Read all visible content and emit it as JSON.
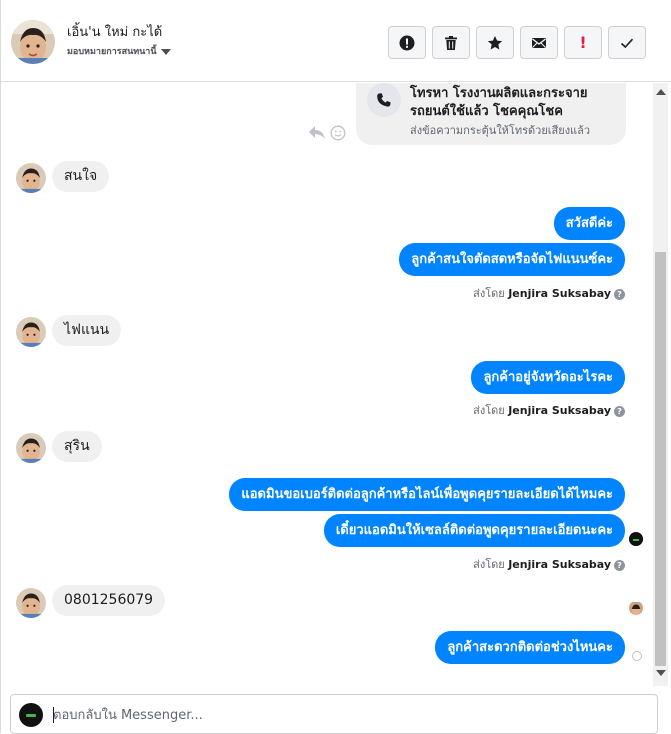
{
  "header": {
    "contact_name": "เอิ้น'น ใหม่ กะได้",
    "assign_label": "มอบหมายการสนทนานี้",
    "tools": [
      {
        "icon": "alert-circle-icon"
      },
      {
        "icon": "trash-icon"
      },
      {
        "icon": "star-icon"
      },
      {
        "icon": "envelope-icon"
      },
      {
        "icon": "exclamation-icon",
        "text": "!"
      },
      {
        "icon": "check-icon"
      }
    ]
  },
  "call_card": {
    "title": "โทรหา โรงงานผลิตและกระจายรถยนต์ใช้แล้ว โชคคุณโชค",
    "subtitle": "ส่งข้อความกระตุ้นให้โทรด้วยเสียงแล้ว"
  },
  "messages": {
    "in1": "สนใจ",
    "out1": "สวัสดีค่ะ",
    "out2": "ลูกค้าสนใจตัดสดหรือจัดไฟแนนซ์คะ",
    "in2": "ไฟแนน",
    "out3": "ลูกค้าอยู่จังหวัดอะไรคะ",
    "in3": "สุริน",
    "out4": "แอดมินขอเบอร์ติดต่อลูกค้าหรือไลน์เพื่อพูดคุยรายละเอียดได้ไหมคะ",
    "out5": "เดี๋ยวแอดมินให้เซลล์ติดต่อพูดคุยรายละเอียดนะคะ",
    "in4": "0801256079",
    "out6": "ลูกค้าสะดวกติดต่อช่วงไหนคะ"
  },
  "sent_by": {
    "prefix": "ส่งโดย",
    "name": "Jenjira Suksabay",
    "help": "?"
  },
  "composer": {
    "placeholder": "ตอบกลับใน Messenger..."
  },
  "colors": {
    "outgoing": "#0084ff",
    "incoming": "#f0f0f0"
  }
}
